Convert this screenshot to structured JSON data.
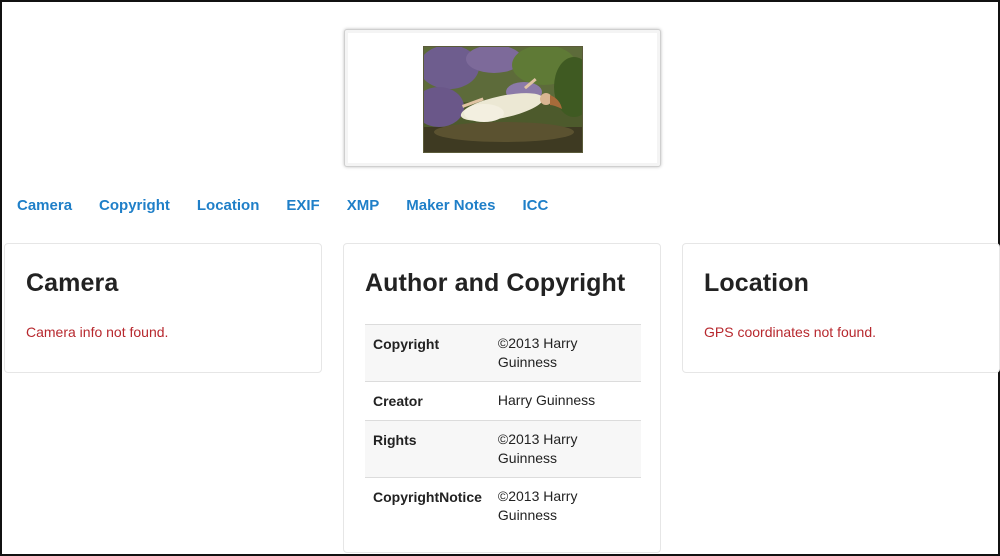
{
  "thumbnail": {
    "alt": "Woman floating in a forest"
  },
  "nav": {
    "items": [
      "Camera",
      "Copyright",
      "Location",
      "EXIF",
      "XMP",
      "Maker Notes",
      "ICC"
    ]
  },
  "camera": {
    "title": "Camera",
    "message": "Camera info not found."
  },
  "copyright": {
    "title": "Author and Copyright",
    "rows": [
      {
        "key": "Copyright",
        "value": "©2013 Harry Guinness"
      },
      {
        "key": "Creator",
        "value": "Harry Guinness"
      },
      {
        "key": "Rights",
        "value": "©2013 Harry Guinness"
      },
      {
        "key": "CopyrightNotice",
        "value": "©2013 Harry Guinness"
      }
    ]
  },
  "location": {
    "title": "Location",
    "message": "GPS coordinates not found."
  },
  "colors": {
    "link": "#1f7fc8",
    "error": "#b7282e",
    "text": "#222222"
  }
}
